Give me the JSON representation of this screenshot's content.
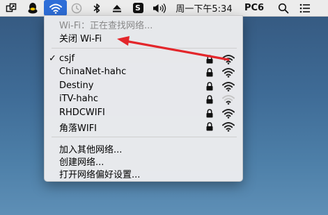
{
  "menubar": {
    "clock_label": "周一下午5:34",
    "user_label": "PC6"
  },
  "wifi_menu": {
    "status": "Wi-Fi：正在查找网络...",
    "toggle": "关闭 Wi-Fi",
    "networks": [
      {
        "name": "csjf",
        "selected": true,
        "locked": true,
        "signal": 4
      },
      {
        "name": "ChinaNet-hahc",
        "selected": false,
        "locked": true,
        "signal": 4
      },
      {
        "name": "Destiny",
        "selected": false,
        "locked": true,
        "signal": 4
      },
      {
        "name": "iTV-hahc",
        "selected": false,
        "locked": true,
        "signal": 2
      },
      {
        "name": "RHDCWIFI",
        "selected": false,
        "locked": true,
        "signal": 4
      },
      {
        "name": "角落WIFI",
        "selected": false,
        "locked": true,
        "signal": 4
      }
    ],
    "actions": [
      {
        "label": "加入其他网络..."
      },
      {
        "label": "创建网络..."
      },
      {
        "label": "打开网络偏好设置..."
      }
    ]
  },
  "colors": {
    "accent": "#2e6ed8",
    "arrow": "#e3262b"
  }
}
